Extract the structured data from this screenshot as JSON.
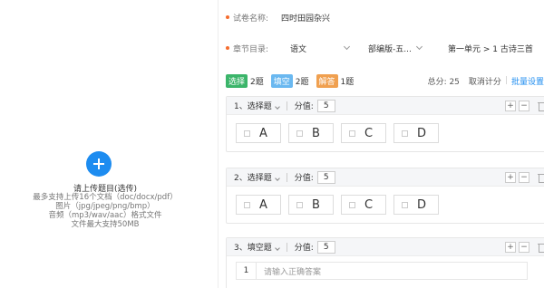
{
  "upload": {
    "title": "请上传题目(选传)",
    "hints": [
      "最多支持上传16个文档（doc/docx/pdf）",
      "图片（jpg/jpeg/png/bmp）",
      "音频（mp3/wav/aac）格式文件",
      "文件最大支持50MB"
    ]
  },
  "form": {
    "name_label": "试卷名称:",
    "name_value": "四时田园杂兴",
    "chapter_label": "章节目录:",
    "subject": "语文",
    "edition": "部编版-五...",
    "unit": "第一单元 > 1 古诗三首"
  },
  "stats": {
    "choice_tag": "选择",
    "choice_count": "2题",
    "fill_tag": "填空",
    "fill_count": "2题",
    "answer_tag": "解答",
    "answer_count": "1题",
    "total": "总分: 25",
    "cancel": "取消计分",
    "separator": "|",
    "batch": "批量设置"
  },
  "questions": [
    {
      "title": "1、选择题",
      "score_label": "分值:",
      "score": "5",
      "options": [
        "A",
        "B",
        "C",
        "D"
      ]
    },
    {
      "title": "2、选择题",
      "score_label": "分值:",
      "score": "5",
      "options": [
        "A",
        "B",
        "C",
        "D"
      ]
    },
    {
      "title": "3、填空题",
      "score_label": "分值:",
      "score": "5",
      "blank_no": "1",
      "blank_placeholder": "请输入正确答案"
    }
  ],
  "tools": {
    "plus": "+",
    "minus": "−"
  }
}
